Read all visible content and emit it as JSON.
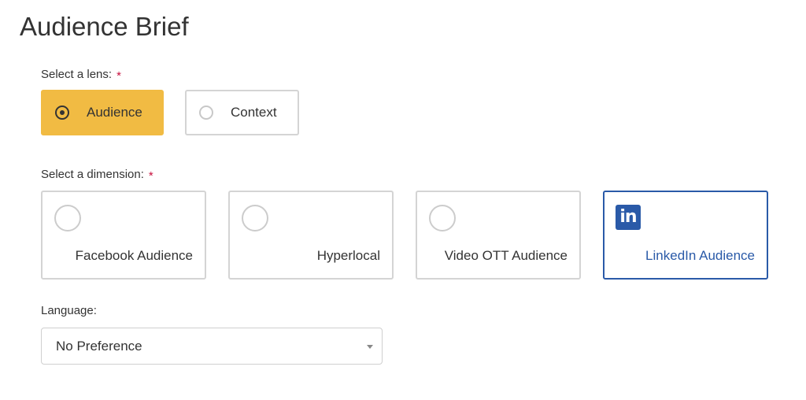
{
  "header": {
    "title": "Audience Brief"
  },
  "lens": {
    "label": "Select a lens:",
    "required_marker": "*",
    "options": [
      {
        "label": "Audience",
        "selected": true
      },
      {
        "label": "Context",
        "selected": false
      }
    ]
  },
  "dimension": {
    "label": "Select a dimension:",
    "required_marker": "*",
    "options": [
      {
        "label": "Facebook Audience",
        "selected": false,
        "icon": "radio-icon"
      },
      {
        "label": "Hyperlocal",
        "selected": false,
        "icon": "radio-icon"
      },
      {
        "label": "Video OTT Audience",
        "selected": false,
        "icon": "radio-icon"
      },
      {
        "label": "LinkedIn Audience",
        "selected": true,
        "icon": "linkedin-icon",
        "icon_text": "in"
      }
    ]
  },
  "language": {
    "label": "Language:",
    "value": "No Preference"
  },
  "colors": {
    "accent_selected": "#f1bb43",
    "linkedin_blue": "#2a5aa8",
    "required": "#c8103e"
  }
}
